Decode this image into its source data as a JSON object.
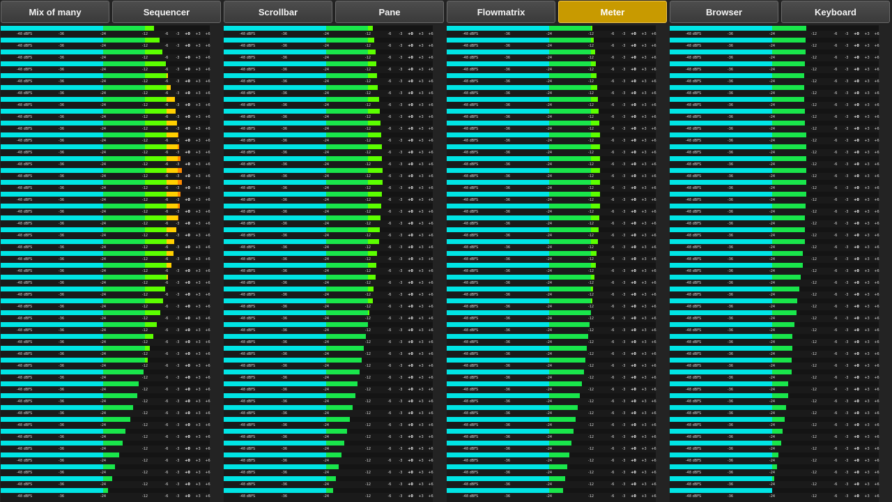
{
  "tabs": [
    "Mix of many",
    "Sequencer",
    "Scrollbar",
    "Pane",
    "Flowmatrix",
    "Meter",
    "Browser",
    "Keyboard"
  ],
  "active_tab": "Meter",
  "scale_labels": [
    "-48 dBFS",
    "-36",
    "-24",
    "-12",
    "-6",
    "-3",
    "+0",
    "+3",
    "+6"
  ],
  "scale_db": [
    -48,
    -36,
    -24,
    -12,
    -6,
    -3,
    0,
    3,
    6
  ],
  "scale_bold": [
    false,
    false,
    false,
    false,
    false,
    false,
    true,
    false,
    false
  ],
  "colors": {
    "background": "#232323",
    "meter_bg": "#1a1a1a",
    "active_tab": "#c89a00",
    "level_low": "#00e5e5",
    "level_mid": "#19e64b",
    "level_high": "#5cff00",
    "level_warn": "#ffd000",
    "level_clip": "#ff8a00"
  },
  "meters_per_column": 40,
  "columns": [
    {
      "name": "mix-of-many",
      "levels_db": [
        -9.4,
        -8,
        -7.2,
        -6.2,
        -5.6,
        -4.9,
        -3.8,
        -3.5,
        -3.2,
        -2.8,
        -2.5,
        -2.2,
        -1.8,
        -1.8,
        -2.2,
        -2.4,
        -2.8,
        -3.4,
        -4,
        -4.2,
        -4.6,
        -5.6,
        -6.3,
        -6.9,
        -7.8,
        -8.8,
        -9.6,
        -10.6,
        -11.2,
        -12.4,
        -13.8,
        -14.2,
        -15.4,
        -16.2,
        -17.6,
        -18.4,
        -19.4,
        -20.6,
        -21.4,
        -22.6
      ]
    },
    {
      "name": "sequencer",
      "levels_db": [
        -10.6,
        -10.2,
        -9.8,
        -9.6,
        -9.4,
        -9.2,
        -9,
        -8.8,
        -8.6,
        -8.4,
        -8.2,
        -8.1,
        -8,
        -8,
        -8.2,
        -8.4,
        -8.6,
        -8.8,
        -9,
        -9.4,
        -9.6,
        -9.8,
        -10.4,
        -10.6,
        -11.6,
        -12,
        -12.6,
        -13.2,
        -13.8,
        -14.4,
        -15,
        -15.6,
        -16.4,
        -17.2,
        -18,
        -18.8,
        -19.6,
        -20.4,
        -21.2,
        -22
      ]
    },
    {
      "name": "scrollbar",
      "levels_db": [
        -11.6,
        -11.2,
        -10.8,
        -10.6,
        -10.4,
        -10.2,
        -10,
        -9.8,
        -9.6,
        -9.4,
        -9.4,
        -9.4,
        -9.4,
        -9.4,
        -9.4,
        -9.4,
        -9.6,
        -9.8,
        -10,
        -10.4,
        -10.6,
        -11,
        -11.4,
        -11.6,
        -12,
        -12.4,
        -12.8,
        -13.2,
        -13.6,
        -14,
        -14.6,
        -15.2,
        -15.8,
        -16.4,
        -17,
        -17.6,
        -18.2,
        -18.8,
        -19.4,
        -20
      ]
    },
    {
      "name": "pane",
      "levels_db": [
        -14.2,
        -14.4,
        -14.4,
        -14.6,
        -14.8,
        -14.8,
        -14.8,
        -14.6,
        -14.6,
        -14.2,
        -14.2,
        -14.2,
        -14.2,
        -14.2,
        -14.2,
        -14.4,
        -14.6,
        -14.6,
        -14.6,
        -15.2,
        -15.2,
        -15.8,
        -16.2,
        -16.8,
        -17,
        -17.6,
        -18.2,
        -18.2,
        -18.4,
        -18.4,
        -19.4,
        -19.4,
        -20,
        -20.4,
        -21,
        -21.4,
        -22.2,
        -22.6,
        -23.4,
        -24
      ]
    }
  ]
}
